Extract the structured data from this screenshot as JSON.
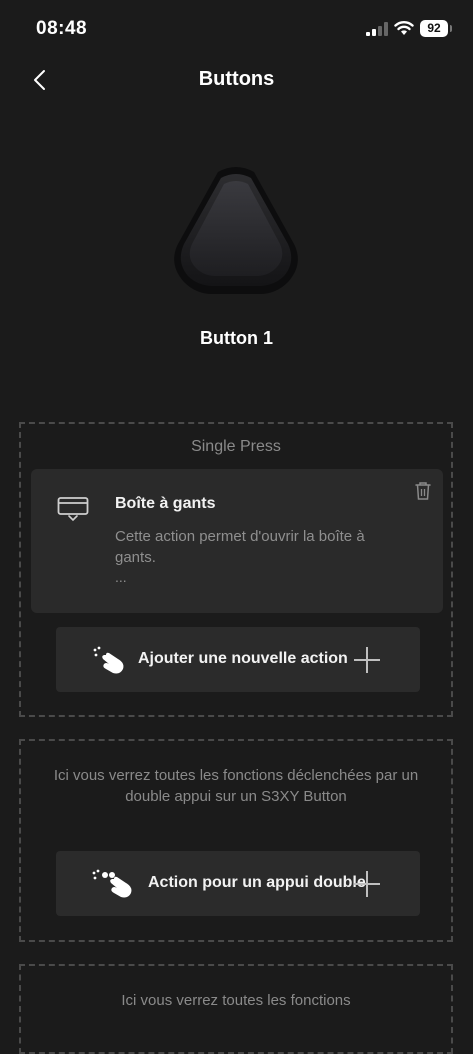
{
  "status_bar": {
    "time": "08:48",
    "battery": "92",
    "signal_icon": "cellular-signal-icon",
    "wifi_icon": "wifi-icon"
  },
  "nav": {
    "title": "Buttons",
    "back_icon": "chevron-left-icon"
  },
  "device": {
    "name": "Button 1",
    "image": "triangular-button-device"
  },
  "single_press": {
    "title": "Single Press",
    "action": {
      "icon": "glovebox-icon",
      "title": "Boîte à gants",
      "description": "Cette action permet d'ouvrir la boîte à gants.",
      "more": "...",
      "delete_icon": "trash-icon"
    },
    "add_button": {
      "label": "Ajouter une nouvelle action",
      "icon": "tap-hand-icon",
      "plus_icon": "plus-icon"
    }
  },
  "double_press": {
    "info": "Ici vous verrez toutes les fonctions déclenchées par un double appui sur un S3XY Button",
    "add_button": {
      "label": "Action pour un appui double",
      "icon": "double-tap-hand-icon",
      "plus_icon": "plus-icon"
    }
  },
  "long_press": {
    "info": "Ici vous verrez toutes les fonctions"
  },
  "colors": {
    "background": "#1b1b1b",
    "card": "#2a2a2a",
    "muted_text": "#8a8a8a",
    "dashed_border": "#4a4a4a"
  }
}
